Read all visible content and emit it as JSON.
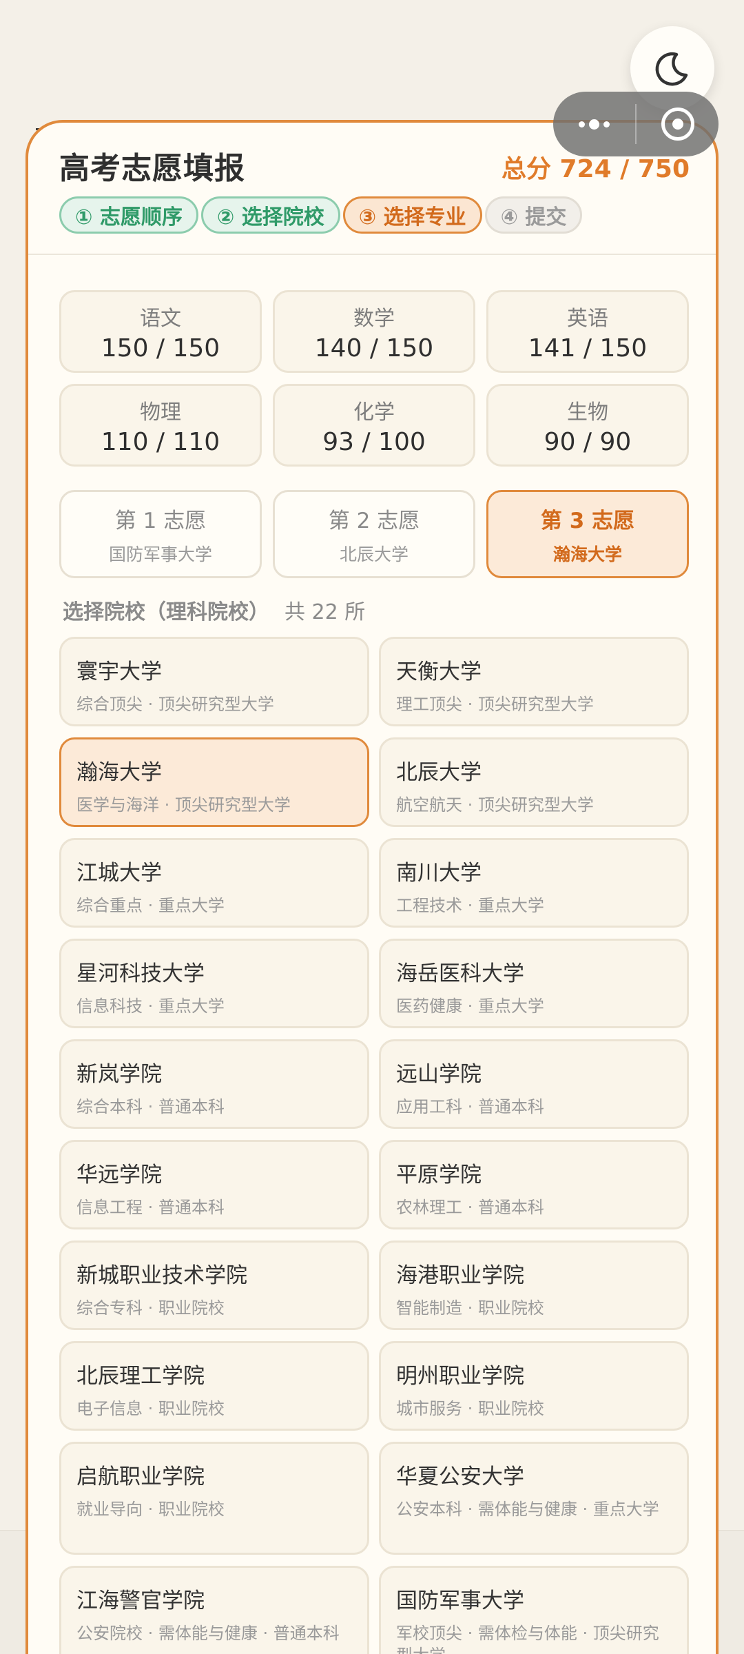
{
  "header": {
    "title": "高考志愿填报",
    "total": "总分 724 / 750"
  },
  "steps": [
    {
      "label": "① 志愿顺序",
      "state": "done"
    },
    {
      "label": "② 选择院校",
      "state": "done"
    },
    {
      "label": "③ 选择专业",
      "state": "active"
    },
    {
      "label": "④ 提交",
      "state": "todo"
    }
  ],
  "scores": [
    {
      "subject": "语文",
      "value": "150 / 150"
    },
    {
      "subject": "数学",
      "value": "140 / 150"
    },
    {
      "subject": "英语",
      "value": "141 / 150"
    },
    {
      "subject": "物理",
      "value": "110 / 110"
    },
    {
      "subject": "化学",
      "value": "93 / 100"
    },
    {
      "subject": "生物",
      "value": "90 / 90"
    }
  ],
  "choices": [
    {
      "title": "第 1 志愿",
      "school": "国防军事大学"
    },
    {
      "title": "第 2 志愿",
      "school": "北辰大学"
    },
    {
      "title": "第 3 志愿",
      "school": "瀚海大学",
      "active": true
    }
  ],
  "section": {
    "title": "选择院校（理科院校）",
    "count": "共 22 所"
  },
  "schools": [
    {
      "name": "寰宇大学",
      "desc": "综合顶尖 · 顶尖研究型大学"
    },
    {
      "name": "天衡大学",
      "desc": "理工顶尖 · 顶尖研究型大学"
    },
    {
      "name": "瀚海大学",
      "desc": "医学与海洋 · 顶尖研究型大学",
      "selected": true
    },
    {
      "name": "北辰大学",
      "desc": "航空航天 · 顶尖研究型大学"
    },
    {
      "name": "江城大学",
      "desc": "综合重点 · 重点大学"
    },
    {
      "name": "南川大学",
      "desc": "工程技术 · 重点大学"
    },
    {
      "name": "星河科技大学",
      "desc": "信息科技 · 重点大学"
    },
    {
      "name": "海岳医科大学",
      "desc": "医药健康 · 重点大学"
    },
    {
      "name": "新岚学院",
      "desc": "综合本科 · 普通本科"
    },
    {
      "name": "远山学院",
      "desc": "应用工科 · 普通本科"
    },
    {
      "name": "华远学院",
      "desc": "信息工程 · 普通本科"
    },
    {
      "name": "平原学院",
      "desc": "农林理工 · 普通本科"
    },
    {
      "name": "新城职业技术学院",
      "desc": "综合专科 · 职业院校"
    },
    {
      "name": "海港职业学院",
      "desc": "智能制造 · 职业院校"
    },
    {
      "name": "北辰理工学院",
      "desc": "电子信息 · 职业院校"
    },
    {
      "name": "明州职业学院",
      "desc": "城市服务 · 职业院校"
    },
    {
      "name": "启航职业学院",
      "desc": "就业导向 · 职业院校"
    },
    {
      "name": "华夏公安大学",
      "desc": "公安本科 · 需体能与健康 · 重点大学"
    },
    {
      "name": "江海警官学院",
      "desc": "公安院校 · 需体能与健康 · 普通本科"
    },
    {
      "name": "国防军事大学",
      "desc": "军校顶尖 · 需体检与体能 · 顶尖研究型大学"
    }
  ],
  "icons": {
    "theme": "moon-icon",
    "menu": "more-dots-icon",
    "close": "target-circle-icon"
  },
  "colors": {
    "accent": "#e08a3c",
    "done": "#2f9a68",
    "background": "#fffcf5"
  }
}
